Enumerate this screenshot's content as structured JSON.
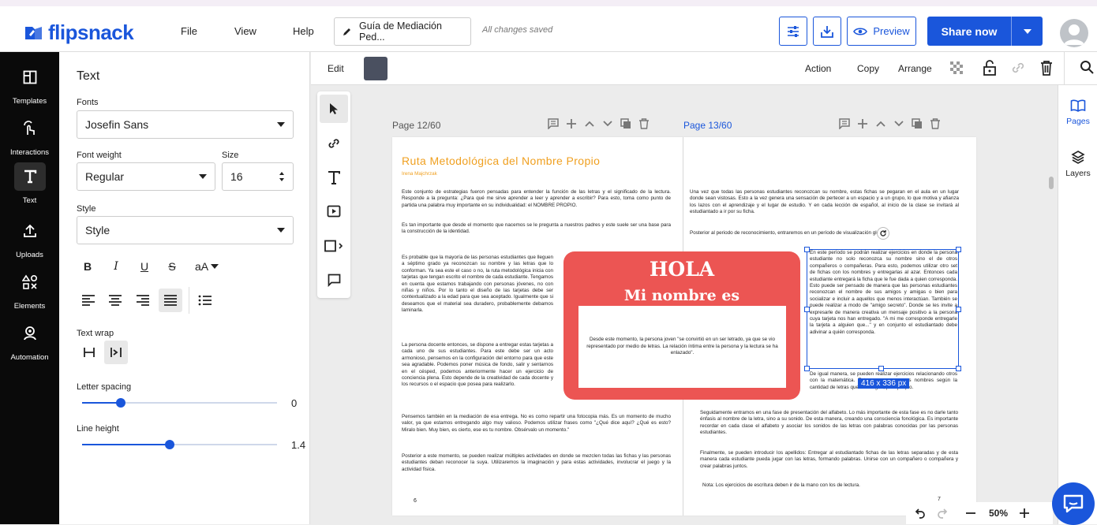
{
  "app": {
    "logo_text": "flipsnack",
    "brand_color": "#1a56db"
  },
  "topbar": {
    "menu": [
      "File",
      "View",
      "Help"
    ],
    "doc_name": "Guía de Mediación Ped...",
    "save_status": "All changes saved",
    "preview_label": "Preview",
    "share_label": "Share now"
  },
  "leftnav": {
    "items": [
      {
        "label": "Templates",
        "icon": "templates-icon"
      },
      {
        "label": "Interactions",
        "icon": "interactions-icon"
      },
      {
        "label": "Text",
        "icon": "text-icon",
        "active": true
      },
      {
        "label": "Uploads",
        "icon": "upload-icon"
      },
      {
        "label": "Elements",
        "icon": "elements-icon"
      },
      {
        "label": "Automation",
        "icon": "automation-icon"
      }
    ]
  },
  "panel": {
    "title": "Text",
    "fonts_label": "Fonts",
    "font_value": "Josefin Sans",
    "weight_label": "Font weight",
    "weight_value": "Regular",
    "size_label": "Size",
    "size_value": "16",
    "style_label": "Style",
    "style_value": "Style",
    "case_label": "aA",
    "text_wrap_label": "Text wrap",
    "letter_spacing_label": "Letter spacing",
    "letter_spacing_value": "0",
    "letter_spacing_fraction": 0.2,
    "line_height_label": "Line height",
    "line_height_value": "1.4",
    "line_height_fraction": 0.45
  },
  "editbar": {
    "edit_label": "Edit",
    "swatch_color": "#4a5060",
    "action_label": "Action",
    "copy_label": "Copy",
    "arrange_label": "Arrange"
  },
  "rightpanel": {
    "pages_label": "Pages",
    "layers_label": "Layers"
  },
  "canvas": {
    "left_page_label": "Page 12/60",
    "right_page_label": "Page 13/60",
    "left": {
      "title": "Ruta Metodológica del Nombre Propio",
      "author": "Irena Majchrzak",
      "p1": "Este conjunto de estrategias fueron pensadas para entender la función de las letras y el significado de la lectura. Responde a la pregunta: ¿Para qué me sirve aprender a leer y aprender a escribir? Para esto, toma como punto de partida una palabra muy importante en su individualidad: el NOMBRE PROPIO.",
      "p2": "Es tan importante que desde el momento que nacemos se le pregunta a nuestros padres y este suele ser una base para la construcción de la identidad.",
      "p3": "Es probable que la mayoría de las personas estudiantes que lleguen a séptimo grado ya reconozcan su nombre y las letras que lo conforman. Ya sea este el caso o no, la ruta metodológica inicia con tarjetas que tengan escrito el nombre de cada estudiante. Tengamos en cuenta que estamos trabajando con personas jóvenes, no con niñas y niños. Por lo tanto el diseño de las tarjetas debe ser contextualizado a la edad para que sea aceptado. Igualmente que si deseamos que el material sea duradero, probablemente debamos laminarla.",
      "p4": "La persona docente entonces, se dispone a entregar estas tarjetas a cada uno de sus estudiantes. Para este debe ser un acto armonioso, pensemos en la configuración del entorno para que este sea agradable. Podemos poner música de fondo, salir y sentarnos en el césped, podemos anteriormente hacer un ejercicio de conciencia plena. Esto depende de la creatividad de cada docente y los recursos o el espacio que posea para realizarlo.",
      "p5": "Pensemos también en la mediación de esa entrega. No es como repartir una fotocopia más. Es un momento de mucho valor, ya que estamos entregando algo muy valioso. Podemos utilizar frases como \"¿Qué dice aquí? ¿Qué es esto? Miralo bien. Muy bien, es cierto, ese es tu nombre. Obsérvalo un momento.\"",
      "p6": "Posterior a este momento, se pueden realizar múltiples actividades en donde se mezclen todas las fichas y las personas estudiantes deban reconocer la suya. Utilizaremos la imaginación y para estas actividades, involucrar el juego y la actividad física.",
      "page_num": "6"
    },
    "card": {
      "line1": "HOLA",
      "line2": "Mi nombre es",
      "body": "Desde este momento, la persona joven \"se convirtió en un ser letrado, ya que se vio representado por medio de letras. La relación íntima entre la persona y la lectura se ha enlazado\"."
    },
    "right": {
      "p1": "Una vez que todas las personas estudiantes reconozcan su nombre, estas fichas se pegaran en el aula en un lugar donde sean vistosas. Esto a la vez genera una sensación de pertecer a un espacio y a un grupo, lo que motiva y afianza los lazos con el aprendizaje y el lugar de estudio. Y en cada lección de español, al inicio de la clase se invitará al estudiantado a ir por su ficha.",
      "p2": "Posterior al periodo de reconocimiento, entraremos en un período de visualización global.",
      "p3": "En este período se podrán realizar ejercicios en donde la persona estudiante no solo reconozca su nombre sino el de otros compañeros o compañeras. Para esto, podemos utilizar otro set de fichas con los nombres y entregarlas al azar. Entonces cada estudiante entregará la ficha que le fue dada a quien corresponda. Esto puede ser pensado de manera que las personas estudiantes reconozcan el nombre de sus amigos y amigas o bien para socializar e incluir a aquellos que menos interactúan. También se puede realizar a modo de \"amigo secreto\". Donde se les invite a expresarle de manera creativa un mensaje positivo a la persona cuya tarjeta nos han entregado. \"A mi me corresponde entregarle la tarjeta a alguien que...\" y en conjunto el estudiantado debe adivinar a quién corresponda.",
      "p4": "De igual manera, se pueden realizar ejercicios relacionando otros con la matemática. Entonces agruparemos nombres según la cantidad de letras que contengan, por ejemplo.",
      "p5": "Seguidamente entramos en una fase de presentación del alfabeto. Lo más importante de esta fase es no darle tanto énfasis al nombre de la letra, sino a su sonido. De esta manera, creando una consciencia fonológica. Es importante recordar en cada clase el alfabeto y asociar los sonidos de las letras con palabras conocidas por las personas estudiantes.",
      "p6": "Finalmente, se pueden introducir los apellidos: Entregar al estudiantado fichas de las letras separadas y de esta manera cada estudiante pueda jugar con las letras, formando palabras. Unirse con un compañero o compañera y crear palabras juntos.",
      "p7": "Nota: Los ejercicios de escritura deben ir de la mano con los de lectura.",
      "page_num": "7"
    },
    "selection_size": "416 x 336 px"
  },
  "zoom": {
    "value": "50%"
  },
  "colors": {
    "card_red": "#ec5553",
    "title_orange": "#f0a020"
  }
}
